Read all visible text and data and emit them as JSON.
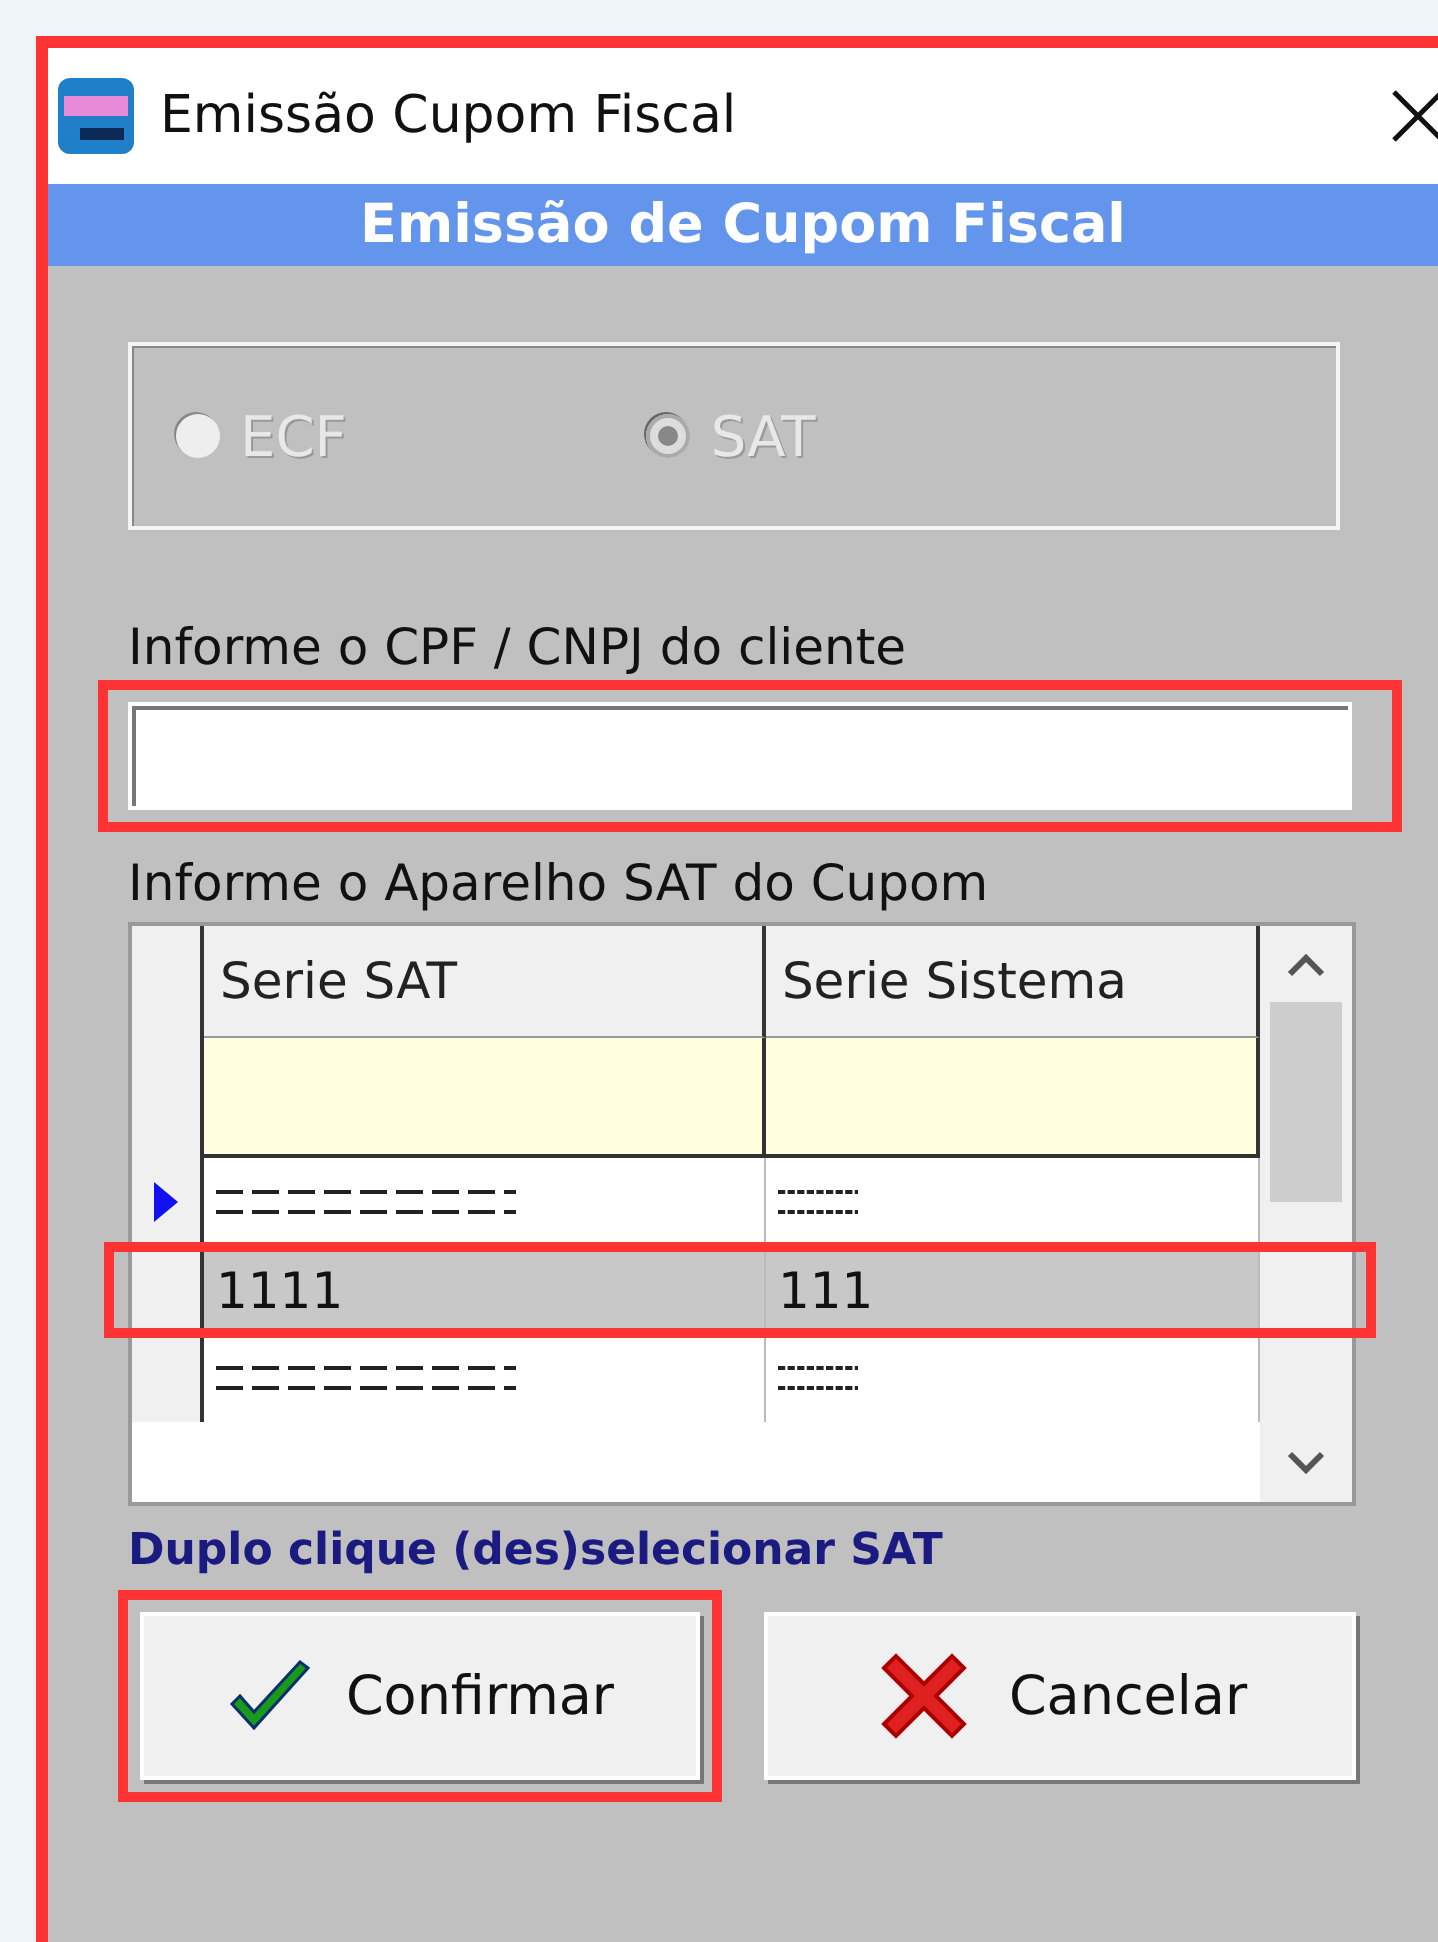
{
  "window": {
    "title": "Emissão Cupom Fiscal",
    "highlighted": true
  },
  "header": "Emissão de Cupom Fiscal",
  "device_options": [
    {
      "label": "ECF",
      "selected": false,
      "disabled": true
    },
    {
      "label": "SAT",
      "selected": true,
      "disabled": true
    }
  ],
  "cpf_field": {
    "label": "Informe o CPF / CNPJ do cliente",
    "highlighted": true
  },
  "sat_table": {
    "label": "Informe o Aparelho SAT do Cupom",
    "columns": [
      "Serie SAT",
      "Serie Sistema"
    ],
    "rows": [
      {
        "kind": "obscured",
        "current": true,
        "highlighted": false,
        "cells": []
      },
      {
        "kind": "text",
        "current": false,
        "highlighted": true,
        "cells": [
          "1111",
          "111"
        ]
      },
      {
        "kind": "obscured",
        "current": false,
        "highlighted": false,
        "cells": []
      }
    ]
  },
  "hint": "Duplo clique (des)selecionar SAT",
  "buttons": [
    {
      "kind": "confirm",
      "label": "Confirmar",
      "highlighted": true
    },
    {
      "kind": "cancel",
      "label": "Cancelar",
      "highlighted": false
    }
  ]
}
